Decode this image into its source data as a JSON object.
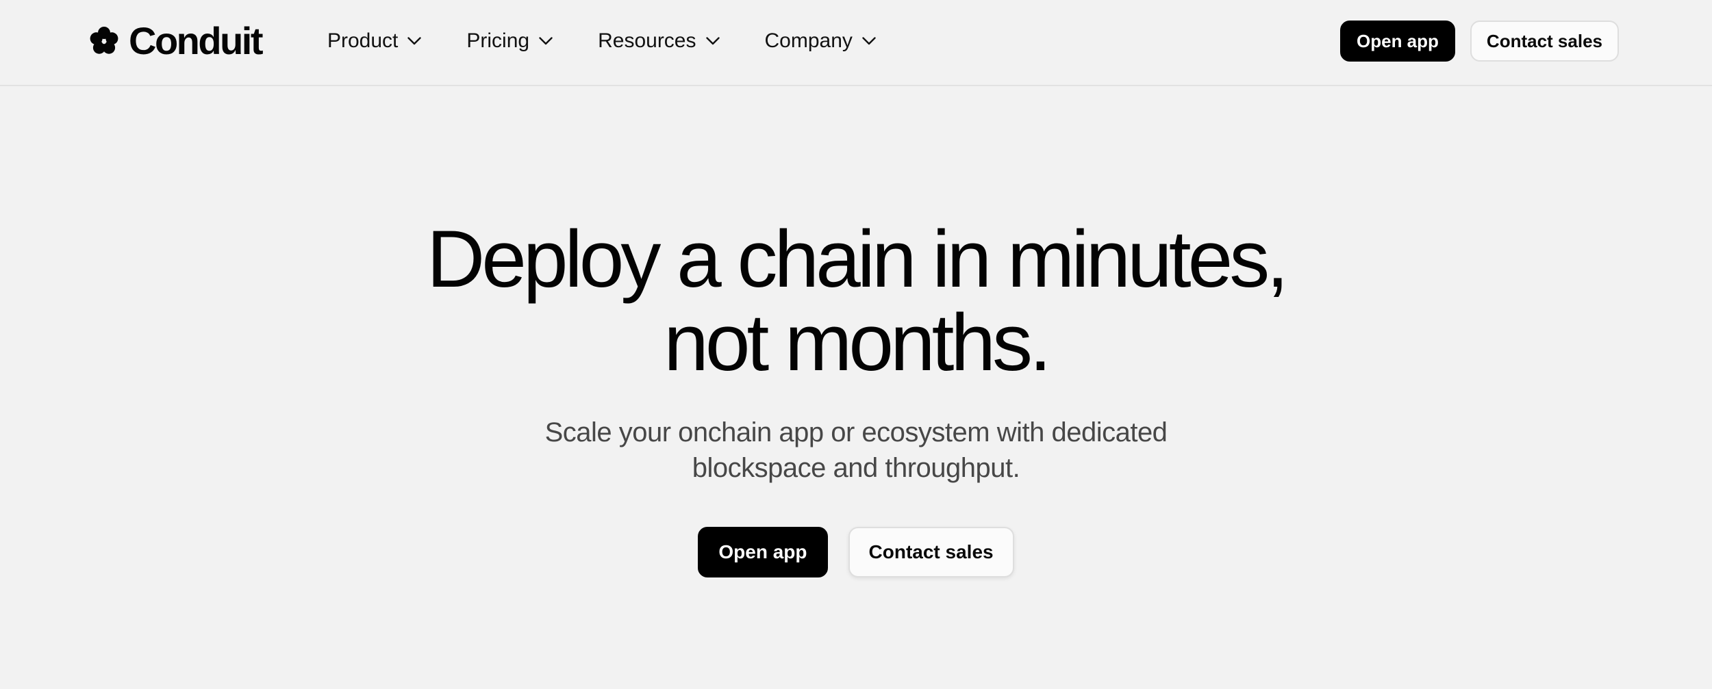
{
  "brand": {
    "name": "Conduit",
    "icon": "flower-logo-icon"
  },
  "nav": {
    "items": [
      {
        "label": "Product",
        "icon": "chevron-down-icon"
      },
      {
        "label": "Pricing",
        "icon": "chevron-down-icon"
      },
      {
        "label": "Resources",
        "icon": "chevron-down-icon"
      },
      {
        "label": "Company",
        "icon": "chevron-down-icon"
      }
    ]
  },
  "header_actions": {
    "open_app_label": "Open app",
    "contact_sales_label": "Contact sales"
  },
  "hero": {
    "title_line1": "Deploy a chain in minutes,",
    "title_line2": "not months.",
    "subtitle_line1": "Scale your onchain app or ecosystem with dedicated",
    "subtitle_line2": "blockspace and throughput.",
    "open_app_label": "Open app",
    "contact_sales_label": "Contact sales"
  },
  "colors": {
    "background": "#f2f2f2",
    "primary_button": "#000000",
    "secondary_button": "#fbfbfb",
    "text": "#0a0a0a",
    "subtitle_text": "#474747"
  }
}
